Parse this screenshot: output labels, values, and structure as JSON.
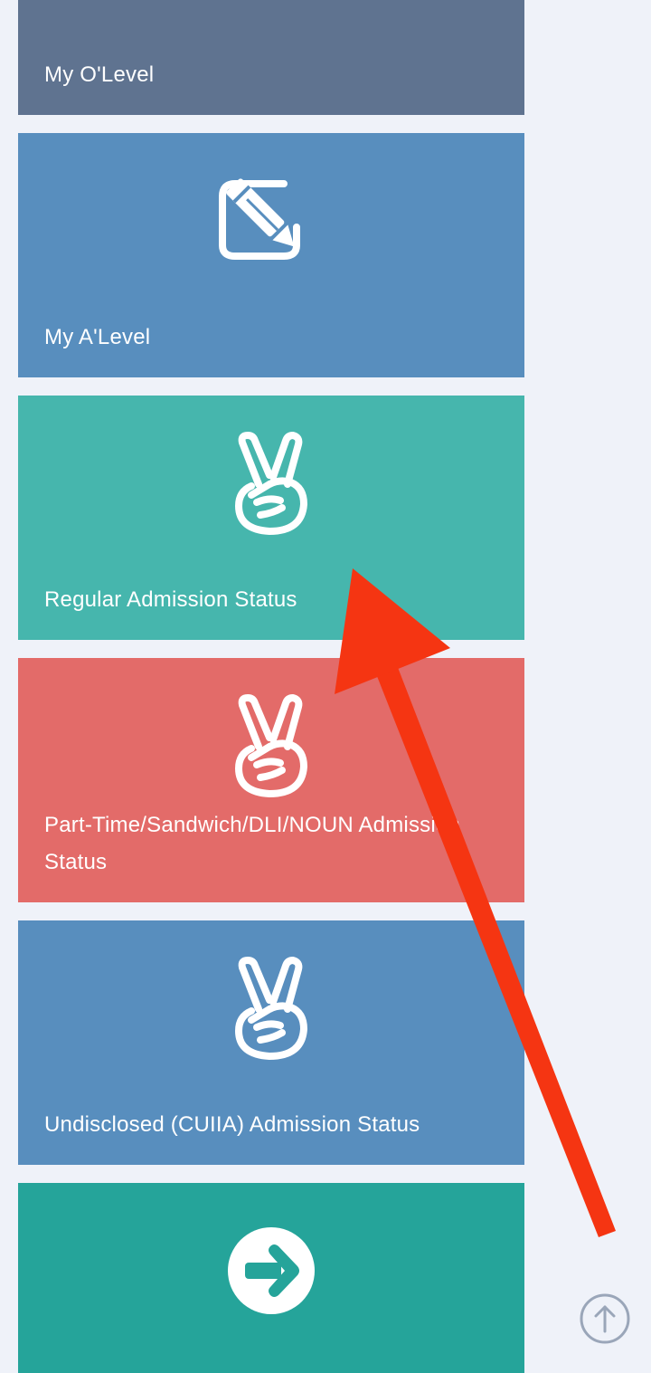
{
  "colors": {
    "page_background": "#eff2f9",
    "annotation_arrow": "#f53512",
    "scroll_top_ring": "#9aa6b9"
  },
  "tiles": [
    {
      "id": "olevel",
      "label": "My O'Level",
      "color": "#5f7390",
      "icon": "none"
    },
    {
      "id": "alevel",
      "label": "My A'Level",
      "color": "#588ebe",
      "icon": "edit-icon"
    },
    {
      "id": "regular",
      "label": "Regular Admission Status",
      "color": "#46b6ad",
      "icon": "victory-hand-icon"
    },
    {
      "id": "parttime",
      "label": "Part-Time/Sandwich/DLI/NOUN Admission Status",
      "color": "#e36b69",
      "icon": "victory-hand-icon"
    },
    {
      "id": "undisclosed",
      "label": "Undisclosed (CUIIA) Admission Status",
      "color": "#588ebe",
      "icon": "victory-hand-icon"
    },
    {
      "id": "next",
      "label": "",
      "color": "#25a49a",
      "icon": "arrow-right-circle-icon"
    }
  ],
  "scroll_top": {
    "icon": "arrow-up-circle-icon"
  }
}
